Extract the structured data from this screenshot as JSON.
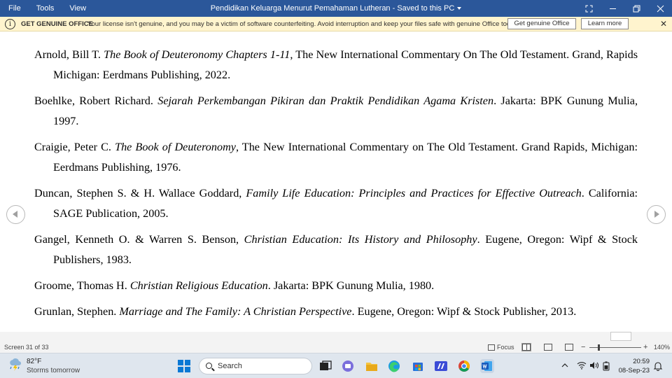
{
  "titlebar": {
    "menu": [
      "File",
      "Tools",
      "View"
    ],
    "title": "Pendidikan Keluarga Menurut Pemahaman Lutheran  -  Saved to this PC"
  },
  "banner": {
    "heading": "GET GENUINE OFFICE",
    "message": "Your license isn't genuine, and you may be a victim of software counterfeiting. Avoid interruption and keep your files safe with genuine Office today.",
    "get_label": "Get genuine Office",
    "learn_label": "Learn more"
  },
  "references": [
    {
      "pre": "Arnold, Bill T. ",
      "title": "The Book of Deuteronomy Chapters 1-11",
      "post": ", The New International Commentary On The Old Testament. Grand, Rapids Michigan: Eerdmans Publishing, 2022."
    },
    {
      "pre": "Boehlke, Robert Richard. ",
      "title": "Sejarah Perkembangan Pikiran dan Praktik Pendidikan Agama Kristen",
      "post": ". Jakarta: BPK Gunung Mulia, 1997."
    },
    {
      "pre": "Craigie, Peter C. ",
      "title": "The Book of Deuteronomy",
      "post": ", The New International Commentary on The Old Testament. Grand Rapids, Michigan: Eerdmans Publishing, 1976."
    },
    {
      "pre": "Duncan, Stephen S. & H. Wallace Goddard, ",
      "title": "Family Life Education: Principles and Practices for Effective Outreach",
      "post": ". California: SAGE Publication, 2005."
    },
    {
      "pre": "Gangel, Kenneth O. & Warren S. Benson, ",
      "title": "Christian Education: Its History and Philosophy",
      "post": ". Eugene, Oregon: Wipf & Stock Publishers, 1983."
    },
    {
      "pre": "Groome, Thomas H. ",
      "title": "Christian Religious Education",
      "post": ". Jakarta: BPK Gunung Mulia, 1980."
    },
    {
      "pre": "Grunlan, Stephen. ",
      "title": "Marriage and The Family: A Christian Perspective",
      "post": ". Eugene, Oregon: Wipf & Stock Publisher, 2013."
    }
  ],
  "status": {
    "screen": "Screen 31 of 33",
    "focus_label": "Focus",
    "zoom_minus": "−",
    "zoom_plus": "+",
    "zoom_level": "140%",
    "zoom_fraction": 0.18
  },
  "taskbar": {
    "temperature": "82°F",
    "forecast": "Storms tomorrow",
    "search_label": "Search",
    "time": "20:59",
    "date": "08-Sep-23"
  },
  "colors": {
    "titlebar": "#2b579a",
    "banner": "#fff4ce",
    "taskbar": "#dfe6ee"
  }
}
